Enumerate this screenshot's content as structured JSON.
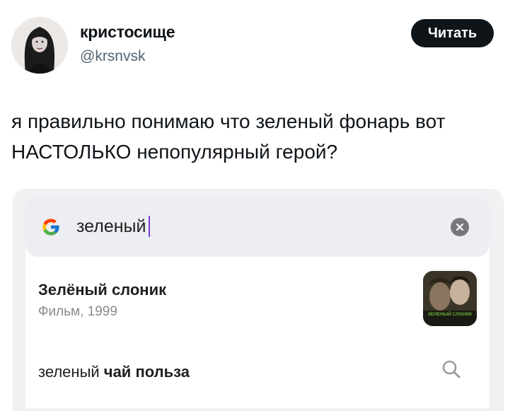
{
  "tweet": {
    "author": {
      "display_name": "кристосище",
      "handle": "@krsnvsk"
    },
    "follow_label": "Читать",
    "text": "я правильно понимаю что зеленый фонарь вот НАСТОЛЬКО непопулярный герой?"
  },
  "screenshot": {
    "search": {
      "query": "зеленый",
      "logo_icon": "google-g-icon",
      "clear_icon": "clear-icon"
    },
    "suggestions": [
      {
        "title": "Зелёный слоник",
        "subtitle": "Фильм, 1999",
        "thumbnail_caption": "ЗЕЛЕНЫЙ СЛОНИК"
      },
      {
        "prefix": "зеленый",
        "completion": "чай польза",
        "icon": "search-icon"
      }
    ]
  },
  "colors": {
    "follow_button_bg": "#0f1419",
    "handle_gray": "#536471",
    "cursor_purple": "#7b3fd6",
    "searchbar_bg": "#eceef2"
  }
}
